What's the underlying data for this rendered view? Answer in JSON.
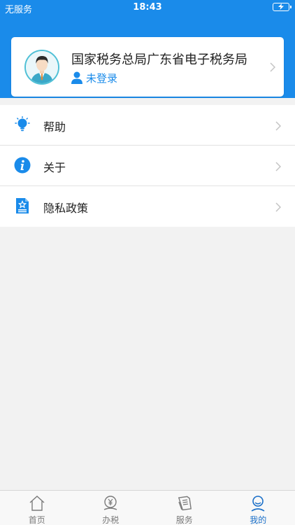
{
  "status_bar": {
    "carrier": "无服务",
    "time": "18:43"
  },
  "colors": {
    "brand_blue": "#1a8bea",
    "background": "#f2f2f2",
    "active_tab": "#1a6fc8"
  },
  "profile": {
    "org_name": "国家税务总局广东省电子税务局",
    "login_status": "未登录",
    "avatar_icon": "person-avatar-icon",
    "user_icon": "user-icon"
  },
  "menu": {
    "items": [
      {
        "label": "帮助",
        "icon": "lightbulb-icon"
      },
      {
        "label": "关于",
        "icon": "info-icon"
      },
      {
        "label": "隐私政策",
        "icon": "document-star-icon"
      }
    ]
  },
  "tabbar": {
    "tabs": [
      {
        "label": "首页",
        "icon": "home-icon",
        "active": false
      },
      {
        "label": "办税",
        "icon": "yuan-coin-icon",
        "active": false
      },
      {
        "label": "服务",
        "icon": "service-icon",
        "active": false
      },
      {
        "label": "我的",
        "icon": "profile-icon",
        "active": true
      }
    ]
  }
}
